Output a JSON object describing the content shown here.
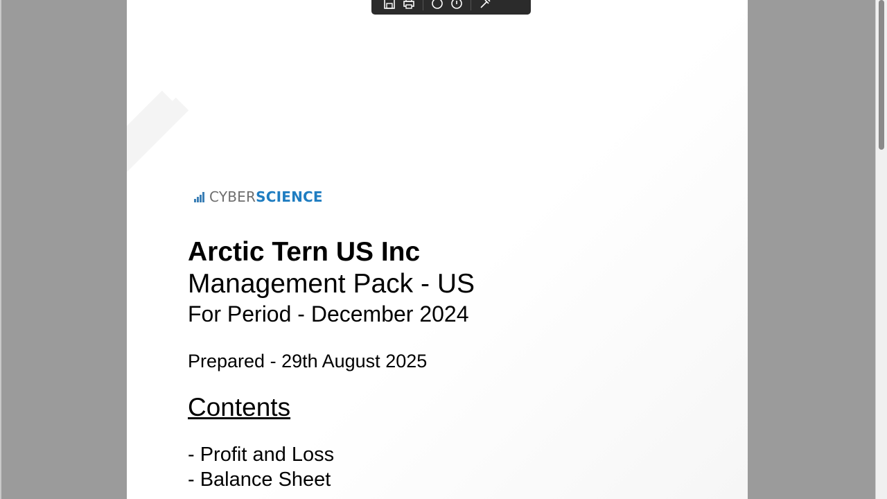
{
  "toolbar": {
    "buttons": [
      {
        "icon": "save-icon"
      },
      {
        "icon": "print-icon"
      },
      {
        "icon": "rotate-left-icon"
      },
      {
        "icon": "rotate-right-icon"
      },
      {
        "icon": "annotate-icon"
      }
    ]
  },
  "logo": {
    "text_part1": "CYBER",
    "text_part2": "SCIENCE",
    "color_primary": "#1f7dc1",
    "color_secondary": "#6e6e6e"
  },
  "document": {
    "company": "Arctic Tern US Inc",
    "pack_title": "Management Pack - US",
    "period": "For Period - December 2024",
    "prepared": "Prepared - 29th August 2025",
    "contents_heading": "Contents",
    "contents_items": [
      "- Profit and Loss",
      "- Balance Sheet"
    ]
  },
  "scrollbar": {
    "position_fraction": 0.0
  }
}
